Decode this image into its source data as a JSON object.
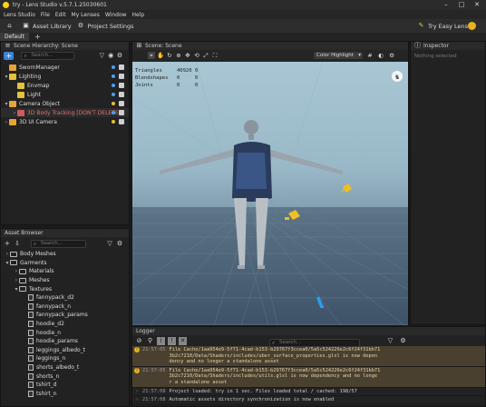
{
  "window": {
    "title": "try - Lens Studio v.5.7.1.25030601"
  },
  "menu": [
    "Lens Studio",
    "File",
    "Edit",
    "My Lenses",
    "Window",
    "Help"
  ],
  "toolbar": {
    "asset_library": "Asset Library",
    "project_settings": "Project Settings",
    "try_easy_lens": "Try Easy Lens"
  },
  "tabs": {
    "default": "Default",
    "add": "+"
  },
  "scene_hierarchy": {
    "title": "Scene Hierarchy: Scene",
    "search_placeholder": "Search...",
    "items": [
      {
        "label": "SwornManager",
        "indent": 0,
        "icon": "object-icon",
        "color": "#e6a338",
        "chev": "",
        "dot": "#4aa0f5"
      },
      {
        "label": "Lighting",
        "indent": 0,
        "icon": "light-icon",
        "color": "#e6c238",
        "chev": "▾",
        "dot": "#4aa0f5"
      },
      {
        "label": "Envmap",
        "indent": 1,
        "icon": "light-icon",
        "color": "#e6c238",
        "chev": "",
        "dot": "#4aa0f5"
      },
      {
        "label": "Light",
        "indent": 1,
        "icon": "light-icon",
        "color": "#e6c238",
        "chev": "",
        "dot": "#4aa0f5"
      },
      {
        "label": "Camera Object",
        "indent": 0,
        "icon": "camera-icon",
        "color": "#e6a338",
        "chev": "▾",
        "dot": "#e6c238"
      },
      {
        "label": "3D Body Tracking [DON'T DELETE]",
        "indent": 1,
        "icon": "body-tracking-icon",
        "color": "#d05a5a",
        "chev": "›",
        "dot": "#4aa0f5"
      },
      {
        "label": "3D UI Camera",
        "indent": 0,
        "icon": "camera-icon",
        "color": "#e6a338",
        "chev": "›",
        "dot": "#e6c238"
      }
    ]
  },
  "asset_browser": {
    "title": "Asset Browser",
    "search_placeholder": "Search...",
    "items": [
      {
        "label": "Body Meshes",
        "indent": 0,
        "type": "folder",
        "chev": "›"
      },
      {
        "label": "Garments",
        "indent": 0,
        "type": "folder",
        "chev": "▾"
      },
      {
        "label": "Materials",
        "indent": 1,
        "type": "folder",
        "chev": "›"
      },
      {
        "label": "Meshes",
        "indent": 1,
        "type": "folder",
        "chev": "›"
      },
      {
        "label": "Textures",
        "indent": 1,
        "type": "folder",
        "chev": "▾"
      },
      {
        "label": "fannypack_d2",
        "indent": 2,
        "type": "file",
        "chev": ""
      },
      {
        "label": "fannypack_n",
        "indent": 2,
        "type": "file",
        "chev": ""
      },
      {
        "label": "fannypack_params",
        "indent": 2,
        "type": "file",
        "chev": ""
      },
      {
        "label": "hoodie_d2",
        "indent": 2,
        "type": "file",
        "chev": ""
      },
      {
        "label": "hoodie_n",
        "indent": 2,
        "type": "file",
        "chev": ""
      },
      {
        "label": "hoodie_params",
        "indent": 2,
        "type": "file",
        "chev": ""
      },
      {
        "label": "leggings_albedo_t",
        "indent": 2,
        "type": "file",
        "chev": ""
      },
      {
        "label": "leggings_n",
        "indent": 2,
        "type": "file",
        "chev": ""
      },
      {
        "label": "shorts_albedo_t",
        "indent": 2,
        "type": "file",
        "chev": ""
      },
      {
        "label": "shorts_n",
        "indent": 2,
        "type": "file",
        "chev": ""
      },
      {
        "label": "tshirt_d",
        "indent": 2,
        "type": "file",
        "chev": ""
      },
      {
        "label": "tshirt_n",
        "indent": 2,
        "type": "file",
        "chev": ""
      }
    ]
  },
  "scene_panel": {
    "title": "Scene: Scene",
    "highlight_option": "Color Highlight",
    "stats": [
      {
        "label": "Triangles",
        "a": "40920",
        "b": "0"
      },
      {
        "label": "Blendshapes",
        "a": "0",
        "b": "0"
      },
      {
        "label": "Joints",
        "a": "0",
        "b": "0"
      }
    ]
  },
  "inspector": {
    "title": "Inspector",
    "empty": "Nothing selected"
  },
  "logger": {
    "title": "Logger",
    "search_placeholder": "Search...",
    "entries": [
      {
        "kind": "warn",
        "time": "21:57:05",
        "text": "File Cache/1aa954e9-5f71-4cad-b153-b29767f3ccea0/5a5c524226e2c6f24f31bb71\n3b2c7210/Data/Shaders/includes/uber_surface_properties.glsl is now depen\ndency and no longer a standalone asset"
      },
      {
        "kind": "warn",
        "time": "21:57:05",
        "text": "File Cache/1aa954e9-5f71-4cad-b153-b29767f3ccea0/5a5c524226e2c6f24f31bb71\n3b2c7210/Data/Shaders/includes/utils.glsl is now dependency and no longe\nr a standalone asset"
      },
      {
        "kind": "info",
        "time": "21:57:08",
        "text": "Project loaded: try in 1 sec. Files loaded total / cached: 198/57"
      },
      {
        "kind": "info",
        "time": "21:57:08",
        "text": "Automatic assets directory synchronization is now enabled"
      }
    ]
  },
  "colors": {
    "accent": "#3b82d6",
    "warn_bg": "#4a4030",
    "warn_icon": "#e6b420"
  }
}
